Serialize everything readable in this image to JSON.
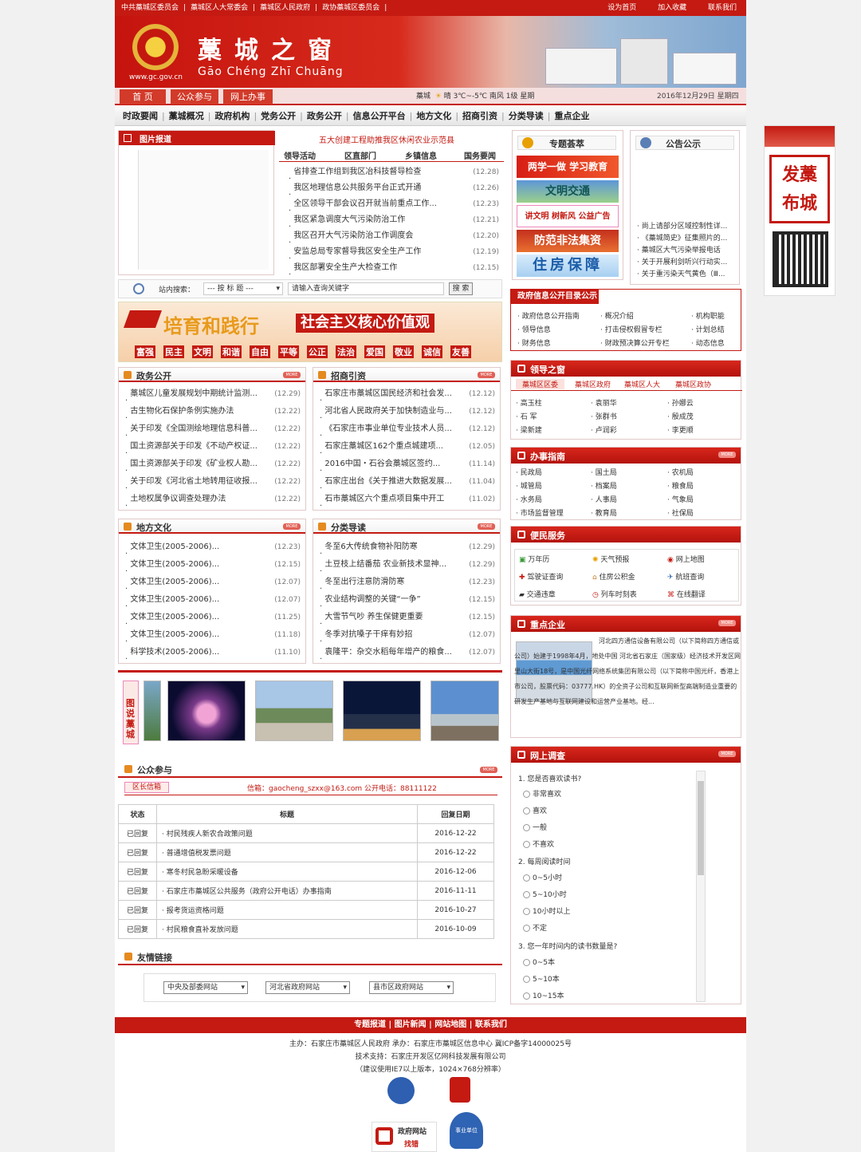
{
  "topbar": {
    "links": [
      "中共藁城区委员会",
      "|",
      "藁城区人大常委会",
      "|",
      "藁城区人民政府",
      "|",
      "政协藁城区委员会",
      "|"
    ],
    "right": [
      "设为首页",
      "加入收藏",
      "联系我们"
    ]
  },
  "header": {
    "domain": "www.gc.gov.cn",
    "title": "藁城之窗",
    "pinyin": "Gāo Chéng Zhī Chuāng"
  },
  "nav": {
    "tabs": [
      "首 页",
      "公众参与",
      "网上办事"
    ],
    "city": "藁城",
    "weather": "晴 3℃~-5℃  南风 1级  星期",
    "date": "2016年12月29日 星期四"
  },
  "menu": [
    "时政要闻",
    "藁城概况",
    "政府机构",
    "党务公开",
    "政务公开",
    "信息公开平台",
    "地方文化",
    "招商引资",
    "分类导读",
    "重点企业"
  ],
  "photo_news": {
    "title": "图片报道"
  },
  "headline": {
    "top": "五大创建工程助推我区休闲农业示范县",
    "tabs": [
      "领导活动",
      "区直部门",
      "乡镇信息",
      "国务要闻"
    ],
    "items": [
      {
        "t": "省排查工作组到我区冶科技督导检查",
        "d": "(12.28)"
      },
      {
        "t": "我区地理信息公共服务平台正式开通",
        "d": "(12.26)"
      },
      {
        "t": "全区领导干部会议召开就当前重点工作...",
        "d": "(12.23)"
      },
      {
        "t": "我区紧急调度大气污染防治工作",
        "d": "(12.21)"
      },
      {
        "t": "我区召开大气污染防治工作调度会",
        "d": "(12.20)"
      },
      {
        "t": "安监总局专家督导我区安全生产工作",
        "d": "(12.19)"
      },
      {
        "t": "我区部署安全生产大检查工作",
        "d": "(12.15)"
      }
    ]
  },
  "search": {
    "label": "站内搜索：",
    "option": "--- 按 标 题 ---",
    "placeholder": "请输入查询关键字",
    "button": "搜 索"
  },
  "slogan": {
    "main": "培育和践行",
    "sub": "社会主义核心价值观",
    "words": [
      "富强",
      "民主",
      "文明",
      "和谐",
      "自由",
      "平等",
      "公正",
      "法治",
      "爱国",
      "敬业",
      "诚信",
      "友善"
    ]
  },
  "gov_open": {
    "title": "政务公开",
    "items": [
      {
        "t": "藁城区儿童发展规划中期统计监测...",
        "d": "(12.29)"
      },
      {
        "t": "古生物化石保护条例实施办法",
        "d": "(12.22)"
      },
      {
        "t": "关于印发《全国测绘地理信息科普...",
        "d": "(12.22)"
      },
      {
        "t": "国土资源部关于印发《不动产权证...",
        "d": "(12.22)"
      },
      {
        "t": "国土资源部关于印发《矿业权人勘...",
        "d": "(12.22)"
      },
      {
        "t": "关于印发《河北省土地转用征收报...",
        "d": "(12.22)"
      },
      {
        "t": "土地权属争议调查处理办法",
        "d": "(12.22)"
      }
    ]
  },
  "invest": {
    "title": "招商引资",
    "items": [
      {
        "t": "石家庄市藁城区国民经济和社会发...",
        "d": "(12.12)"
      },
      {
        "t": "河北省人民政府关于加快制造业与...",
        "d": "(12.12)"
      },
      {
        "t": "《石家庄市事业单位专业技术人员...",
        "d": "(12.12)"
      },
      {
        "t": "石家庄藁城区162个重点城建项...",
        "d": "(12.05)"
      },
      {
        "t": "2016中国・石谷会藁城区签约...",
        "d": "(11.14)"
      },
      {
        "t": "石家庄出台《关于推进大数据发展...",
        "d": "(11.04)"
      },
      {
        "t": "石市藁城区六个重点项目集中开工",
        "d": "(11.02)"
      }
    ]
  },
  "culture": {
    "title": "地方文化",
    "items": [
      {
        "t": "文体卫生(2005-2006)...",
        "d": "(12.23)"
      },
      {
        "t": "文体卫生(2005-2006)...",
        "d": "(12.15)"
      },
      {
        "t": "文体卫生(2005-2006)...",
        "d": "(12.07)"
      },
      {
        "t": "文体卫生(2005-2006)...",
        "d": "(12.07)"
      },
      {
        "t": "文体卫生(2005-2006)...",
        "d": "(11.25)"
      },
      {
        "t": "文体卫生(2005-2006)...",
        "d": "(11.18)"
      },
      {
        "t": "科学技术(2005-2006)...",
        "d": "(11.10)"
      }
    ]
  },
  "guide": {
    "title": "分类导读",
    "items": [
      {
        "t": "冬至6大传统食物补阳防寒",
        "d": "(12.29)"
      },
      {
        "t": "土豆枝上结番茄 农业新技术显神...",
        "d": "(12.29)"
      },
      {
        "t": "冬至出行注意防滑防寒",
        "d": "(12.23)"
      },
      {
        "t": "农业结构调整的关键“一争”",
        "d": "(12.15)"
      },
      {
        "t": "大雪节气吵 养生保健更重要",
        "d": "(12.15)"
      },
      {
        "t": "冬季对抗嗓子干痒有妙招",
        "d": "(12.07)"
      },
      {
        "t": "袁隆平：杂交水稻每年增产的粮食...",
        "d": "(12.07)"
      }
    ]
  },
  "gallery": {
    "title": "图说藁城"
  },
  "public": {
    "title": "公众参与",
    "tab": "区长信箱",
    "contact": "信箱：gaocheng_szxx@163.com 公开电话：88111122",
    "headers": [
      "状态",
      "标题",
      "回复日期"
    ],
    "rows": [
      [
        "已回复",
        "村民残疾人新农合政策问题",
        "2016-12-22"
      ],
      [
        "已回复",
        "普通增值税发票问题",
        "2016-12-22"
      ],
      [
        "已回复",
        "寒冬村民急盼采暖设备",
        "2016-12-06"
      ],
      [
        "已回复",
        "石家庄市藁城区公共服务（政府公开电话）办事指南",
        "2016-11-11"
      ],
      [
        "已回复",
        "报考货运资格问题",
        "2016-10-27"
      ],
      [
        "已回复",
        "村民粮食直补发放问题",
        "2016-10-09"
      ]
    ]
  },
  "links": {
    "title": "友情链接",
    "selects": [
      "中央及部委网站",
      "河北省政府网站",
      "县市区政府网站"
    ]
  },
  "special": {
    "title": "专题荟萃",
    "banners": [
      "两学一做 学习教育",
      "文明交通",
      "讲文明 树新风 公益广告",
      "防范非法集资",
      "住房保障"
    ]
  },
  "notice": {
    "title": "公告公示",
    "items": [
      "尚上请部分区域控制性详...",
      "《藁城简史》征集照片的...",
      "藁城区大气污染举报电话",
      "关于开展利剑听兴行动实...",
      "关于重污染天气黄色（Ⅲ..."
    ]
  },
  "gov_info": {
    "title": "政府信息公开目录公示",
    "items": [
      "政府信息公开指南",
      "概况介绍",
      "机构职能",
      "领导信息",
      "打击侵权假冒专栏",
      "计划总结",
      "财务信息",
      "财政预决算公开专栏",
      "动态信息"
    ]
  },
  "leaders": {
    "title": "领导之窗",
    "tabs": [
      "藁城区区委",
      "藁城区政府",
      "藁城区人大",
      "藁城区政协"
    ],
    "names": [
      "高玉柱",
      "袁丽华",
      "孙娜云",
      "石 军",
      "张群书",
      "殷成茂",
      "梁新建",
      "卢润彩",
      "李更顺"
    ]
  },
  "affairs": {
    "title": "办事指南",
    "items": [
      "民政局",
      "国土局",
      "农机局",
      "城管局",
      "档案局",
      "粮食局",
      "水务局",
      "人事局",
      "气象局",
      "市场监督管理",
      "教育局",
      "社保局"
    ]
  },
  "services": {
    "title": "便民服务",
    "items": [
      "万年历",
      "天气预报",
      "网上地图",
      "驾驶证查询",
      "住房公积金",
      "航班查询",
      "交通违章",
      "列车时刻表",
      "在线翻译"
    ]
  },
  "enterprise": {
    "title": "重点企业",
    "text": "河北四方通信设备有限公司（以下简称四方通信或公司）始建于1998年4月，地处中国 河北省石家庄（国家级）经济技术开发区网里山大街18号，是中国光纤网络系统集团有限公司（以下简称中国光纤，香港上市公司，股票代码：03777.HK）的全资子公司和互联网新型高端制造业重要的研发生产基地与互联网建设和运营产业基地。经..."
  },
  "survey": {
    "title": "网上调查",
    "q1": "1. 您是否喜欢读书?",
    "o1": [
      "非常喜欢",
      "喜欢",
      "一般",
      "不喜欢"
    ],
    "q2": "2. 每周阅读时间",
    "o2": [
      "0~5小时",
      "5~10小时",
      "10小时以上",
      "不定"
    ],
    "q3": "3. 您一年时间内的读书数量是?",
    "o3": [
      "0~5本",
      "5~10本",
      "10~15本"
    ]
  },
  "right_ad": {
    "text": "发藁布城"
  },
  "footer": {
    "links": "专题报道 | 图片新闻 | 网站地图 | 联系我们",
    "l1": "主办：石家庄市藁城区人民政府  承办：石家庄市藁城区信息中心  冀ICP备字14000025号",
    "l2": "技术支持：石家庄开发区亿网科技发展有限公司",
    "l3": "（建议使用IE7以上版本，1024×768分辨率）",
    "badge1": "政府网站",
    "badge2": "找错",
    "badge3": "事业单位"
  },
  "colors": {
    "brand": "#c41a12"
  }
}
